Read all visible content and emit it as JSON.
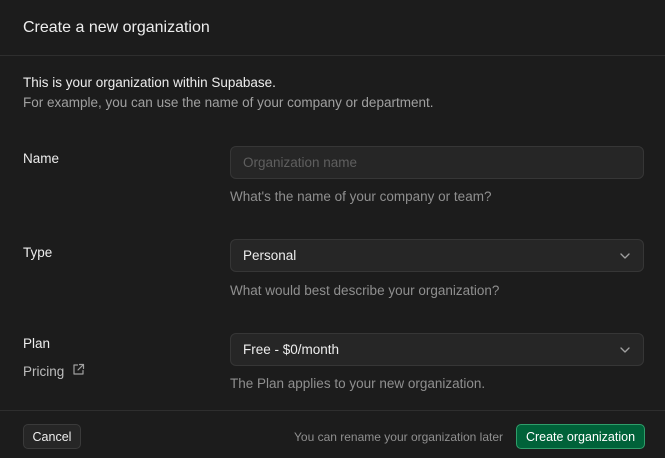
{
  "dialog": {
    "title": "Create a new organization",
    "intro_line1": "This is your organization within Supabase.",
    "intro_line2": "For example, you can use the name of your company or department."
  },
  "fields": {
    "name": {
      "label": "Name",
      "placeholder": "Organization name",
      "value": "",
      "help": "What's the name of your company or team?"
    },
    "type": {
      "label": "Type",
      "selected": "Personal",
      "help": "What would best describe your organization?"
    },
    "plan": {
      "label": "Plan",
      "selected": "Free - $0/month",
      "help": "The Plan applies to your new organization.",
      "pricing_link": "Pricing"
    }
  },
  "footer": {
    "cancel_label": "Cancel",
    "note": "You can rename your organization later",
    "create_label": "Create organization"
  },
  "colors": {
    "background": "#1c1c1c",
    "brand_green": "#006239",
    "brand_green_border": "#2f9e6a"
  },
  "icons": {
    "chevron": "chevron-down-icon",
    "external": "external-link-icon"
  }
}
